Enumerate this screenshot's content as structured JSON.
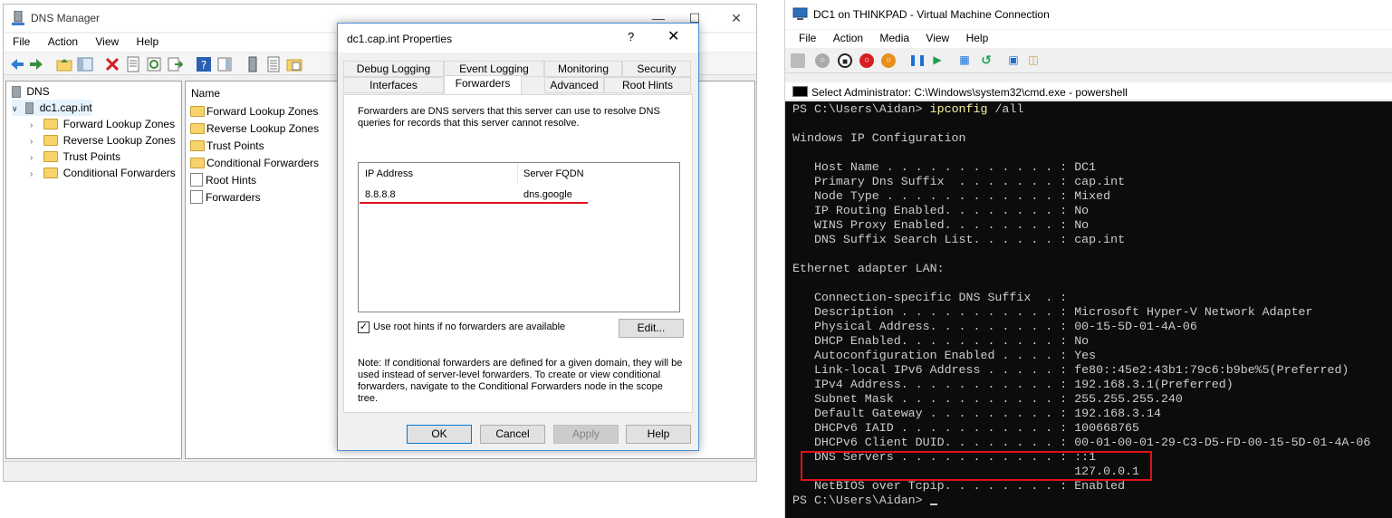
{
  "dns_manager": {
    "title": "DNS Manager",
    "menu": [
      "File",
      "Action",
      "View",
      "Help"
    ],
    "tree": {
      "root": "DNS",
      "server": "dc1.cap.int",
      "children": [
        "Forward Lookup Zones",
        "Reverse Lookup Zones",
        "Trust Points",
        "Conditional Forwarders"
      ]
    },
    "list": {
      "column": "Name",
      "items": [
        "Forward Lookup Zones",
        "Reverse Lookup Zones",
        "Trust Points",
        "Conditional Forwarders",
        "Root Hints",
        "Forwarders"
      ]
    }
  },
  "properties": {
    "title": "dc1.cap.int Properties",
    "help_glyph": "?",
    "close_glyph": "✕",
    "tabs_row1": [
      "Debug Logging",
      "Event Logging",
      "Monitoring",
      "Security"
    ],
    "tabs_row2": [
      "Interfaces",
      "Forwarders",
      "Advanced",
      "Root Hints"
    ],
    "selected_tab": "Forwarders",
    "description": "Forwarders are DNS servers that this server can use to resolve DNS queries for records that this server cannot resolve.",
    "table": {
      "col_ip": "IP Address",
      "col_fqdn": "Server FQDN",
      "rows": [
        {
          "ip": "8.8.8.8",
          "fqdn": "dns.google"
        }
      ]
    },
    "use_root_hints": {
      "label": "Use root hints if no forwarders are available",
      "checked": true
    },
    "edit_label": "Edit...",
    "note": "Note: If conditional forwarders are defined for a given domain, they will be used instead of server-level forwarders.  To create or view conditional forwarders, navigate to the Conditional Forwarders node in the scope tree.",
    "buttons": {
      "ok": "OK",
      "cancel": "Cancel",
      "apply": "Apply",
      "help": "Help"
    }
  },
  "vm": {
    "title": "DC1 on THINKPAD - Virtual Machine Connection",
    "menu": [
      "File",
      "Action",
      "Media",
      "View",
      "Help"
    ],
    "console_title": "Select Administrator: C:\\Windows\\system32\\cmd.exe - powershell",
    "prompt": "PS C:\\Users\\Aidan>",
    "command": "ipconfig",
    "command_arg": "/all",
    "lines": [
      "",
      "Windows IP Configuration",
      "",
      "   Host Name . . . . . . . . . . . . : DC1",
      "   Primary Dns Suffix  . . . . . . . : cap.int",
      "   Node Type . . . . . . . . . . . . : Mixed",
      "   IP Routing Enabled. . . . . . . . : No",
      "   WINS Proxy Enabled. . . . . . . . : No",
      "   DNS Suffix Search List. . . . . . : cap.int",
      "",
      "Ethernet adapter LAN:",
      "",
      "   Connection-specific DNS Suffix  . :",
      "   Description . . . . . . . . . . . : Microsoft Hyper-V Network Adapter",
      "   Physical Address. . . . . . . . . : 00-15-5D-01-4A-06",
      "   DHCP Enabled. . . . . . . . . . . : No",
      "   Autoconfiguration Enabled . . . . : Yes",
      "   Link-local IPv6 Address . . . . . : fe80::45e2:43b1:79c6:b9be%5(Preferred)",
      "   IPv4 Address. . . . . . . . . . . : 192.168.3.1(Preferred)",
      "   Subnet Mask . . . . . . . . . . . : 255.255.255.240",
      "   Default Gateway . . . . . . . . . : 192.168.3.14",
      "   DHCPv6 IAID . . . . . . . . . . . : 100668765",
      "   DHCPv6 Client DUID. . . . . . . . : 00-01-00-01-29-C3-D5-FD-00-15-5D-01-4A-06",
      "   DNS Servers . . . . . . . . . . . : ::1",
      "                                       127.0.0.1",
      "   NetBIOS over Tcpip. . . . . . . . : Enabled"
    ],
    "final_prompt": "PS C:\\Users\\Aidan>"
  },
  "colors": {
    "highlight": "#e0101a",
    "console_bg": "#0c0c0c",
    "command": "#f9f1a5",
    "accent": "#0078d7"
  }
}
